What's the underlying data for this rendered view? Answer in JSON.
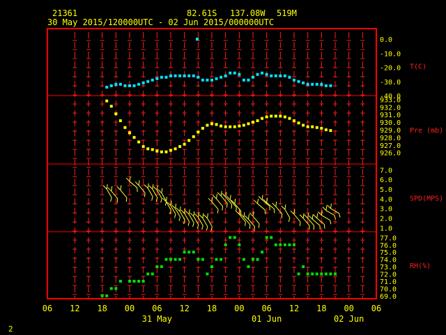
{
  "header": {
    "station": "21361",
    "lat": "82.61S",
    "lon": "137.08W",
    "elev": "519M",
    "time_range": "30 May 2015/120000UTC - 02 Jun 2015/000000UTC"
  },
  "footer": {
    "page_number": "2"
  },
  "colors": {
    "frame": "#ff0000",
    "temp": "#00e5ff",
    "pres": "#ffff00",
    "wind": "#ffff33",
    "rh": "#00e000",
    "text": "#ffff00",
    "axis_text": "#ffff00",
    "panel_label": "#ff2020",
    "tick_red": "#ff2020"
  },
  "chart_data": {
    "type": "scatter",
    "x_unit": "hours from 30 May 2015 06 UTC",
    "x_range": [
      0,
      66
    ],
    "x_tick_labels": [
      "06",
      "12",
      "18",
      "00",
      "06",
      "12",
      "18",
      "00",
      "06",
      "12",
      "18",
      "00",
      "06"
    ],
    "x_ticks": [
      0,
      6,
      12,
      18,
      24,
      30,
      36,
      42,
      48,
      54,
      60,
      66,
      72
    ],
    "date_labels": [
      {
        "hour": 24,
        "text": "31 May"
      },
      {
        "hour": 48,
        "text": "01 Jun"
      },
      {
        "hour": 66,
        "text": "02 Jun"
      }
    ],
    "panels": [
      {
        "name": "temperature",
        "label": "T(C)",
        "ylim": [
          -40,
          2
        ],
        "y_ticks": [
          0,
          -10,
          -20,
          -30,
          -40
        ],
        "y_tick_labels": [
          "0.0",
          "-10.0",
          "-20.0",
          "-30.0",
          "-40.0"
        ],
        "x": [
          13,
          14,
          15,
          16,
          17,
          18,
          19,
          20,
          21,
          22,
          23,
          24,
          25,
          26,
          27,
          28,
          29,
          30,
          31,
          32,
          33,
          34,
          35,
          36,
          37,
          38,
          39,
          40,
          41,
          42,
          43,
          44,
          45,
          46,
          47,
          48,
          49,
          50,
          51,
          52,
          53,
          54,
          55,
          56,
          57,
          58,
          59,
          60,
          61,
          62
        ],
        "y": [
          -34,
          -33,
          -32,
          -32,
          -33,
          -33,
          -33,
          -32,
          -31,
          -30,
          -29,
          -28,
          -27,
          -27,
          -26,
          -26,
          -26,
          -26,
          -26,
          -26,
          -27,
          -29,
          -29,
          -29,
          -28,
          -27,
          -26,
          -24,
          -24,
          -25,
          -29,
          -29,
          -27,
          -25,
          -24,
          -25,
          -26,
          -26,
          -26,
          -26,
          -27,
          -29,
          -30,
          -31,
          -32,
          -32,
          -32,
          -32,
          -33,
          -33
        ],
        "outliers": [
          {
            "x": 32.8,
            "y": 0
          }
        ]
      },
      {
        "name": "pressure",
        "label": "Pre (mb)",
        "ylim": [
          924.5,
          933.5
        ],
        "y_ticks": [
          926,
          927,
          928,
          929,
          930,
          931,
          932,
          933
        ],
        "y_tick_labels": [
          "926.0",
          "927.0",
          "928.0",
          "929.0",
          "930.0",
          "931.0",
          "932.0",
          "933.0"
        ],
        "x": [
          13,
          14,
          15,
          16,
          17,
          18,
          19,
          20,
          21,
          22,
          23,
          24,
          25,
          26,
          27,
          28,
          29,
          30,
          31,
          32,
          33,
          34,
          35,
          36,
          37,
          38,
          39,
          40,
          41,
          42,
          43,
          44,
          45,
          46,
          47,
          48,
          49,
          50,
          51,
          52,
          53,
          54,
          55,
          56,
          57,
          58,
          59,
          60,
          61,
          62
        ],
        "y": [
          932.8,
          932.1,
          931.1,
          930.2,
          929.3,
          928.6,
          928.0,
          927.4,
          926.8,
          926.5,
          926.4,
          926.2,
          926.1,
          926.1,
          926.3,
          926.5,
          926.8,
          927.1,
          927.6,
          928.1,
          928.7,
          929.2,
          929.6,
          929.8,
          929.7,
          929.5,
          929.4,
          929.4,
          929.4,
          929.5,
          929.6,
          929.8,
          930.0,
          930.2,
          930.5,
          930.7,
          930.8,
          930.8,
          930.8,
          930.7,
          930.5,
          930.2,
          929.9,
          929.6,
          929.4,
          929.4,
          929.3,
          929.2,
          929.0,
          928.9
        ]
      },
      {
        "name": "wind",
        "label": "SPD(MPS)",
        "ylim": [
          0.6,
          7.6
        ],
        "y_ticks": [
          1,
          2,
          3,
          4,
          5,
          6,
          7
        ],
        "y_tick_labels": [
          "1.0",
          "2.0",
          "3.0",
          "4.0",
          "5.0",
          "6.0",
          "7.0"
        ],
        "x": [
          13,
          14,
          16,
          18,
          20,
          22,
          23,
          24,
          25,
          26,
          27,
          28,
          29,
          30,
          31,
          32,
          33,
          34,
          35,
          36,
          37,
          38,
          39,
          40,
          41,
          42,
          43,
          44,
          45,
          46,
          47,
          48,
          50,
          52,
          54,
          56,
          57,
          58,
          59,
          60,
          61,
          62
        ],
        "speed": [
          5.0,
          4.8,
          4.9,
          5.8,
          5.4,
          5.1,
          5.0,
          4.9,
          4.6,
          3.7,
          3.3,
          3.0,
          2.7,
          2.5,
          2.4,
          2.2,
          2.1,
          2.0,
          2.0,
          3.7,
          4.0,
          4.3,
          4.2,
          3.9,
          3.5,
          2.4,
          2.1,
          1.9,
          2.2,
          3.5,
          3.9,
          3.6,
          3.2,
          2.9,
          2.4,
          2.0,
          2.0,
          1.9,
          2.0,
          2.3,
          2.8,
          3.0
        ],
        "dir_deg": [
          330,
          320,
          320,
          310,
          320,
          330,
          330,
          330,
          330,
          330,
          330,
          330,
          330,
          330,
          330,
          330,
          330,
          330,
          330,
          320,
          320,
          320,
          320,
          320,
          320,
          320,
          320,
          320,
          320,
          310,
          310,
          310,
          320,
          330,
          320,
          320,
          320,
          310,
          310,
          300,
          300,
          300
        ]
      },
      {
        "name": "rh",
        "label": "RH(%)",
        "ylim": [
          68.6,
          77.8
        ],
        "y_ticks": [
          69,
          70,
          71,
          72,
          73,
          74,
          75,
          76,
          77
        ],
        "y_tick_labels": [
          "69.0",
          "70.0",
          "71.0",
          "72.0",
          "73.0",
          "74.0",
          "75.0",
          "76.0",
          "77.0"
        ],
        "x": [
          12,
          13,
          14,
          15,
          16,
          18,
          19,
          20,
          21,
          22,
          23,
          24,
          25,
          26,
          27,
          28,
          29,
          30,
          31,
          32,
          33,
          34,
          35,
          36,
          37,
          38,
          39,
          40,
          41,
          42,
          43,
          44,
          45,
          46,
          47,
          48,
          49,
          50,
          51,
          52,
          53,
          54,
          55,
          56,
          57,
          58,
          59,
          60,
          61,
          62,
          63
        ],
        "y": [
          69,
          69,
          70,
          70,
          71,
          71,
          71,
          71,
          71,
          72,
          72,
          73,
          73,
          74,
          74,
          74,
          74,
          75,
          75,
          75,
          74,
          74,
          72,
          73,
          74,
          74,
          76,
          77,
          77,
          76,
          74,
          73,
          74,
          74,
          75,
          77,
          77,
          76,
          76,
          76,
          76,
          76,
          72,
          73,
          72,
          72,
          72,
          72,
          72,
          72,
          72
        ]
      }
    ]
  }
}
